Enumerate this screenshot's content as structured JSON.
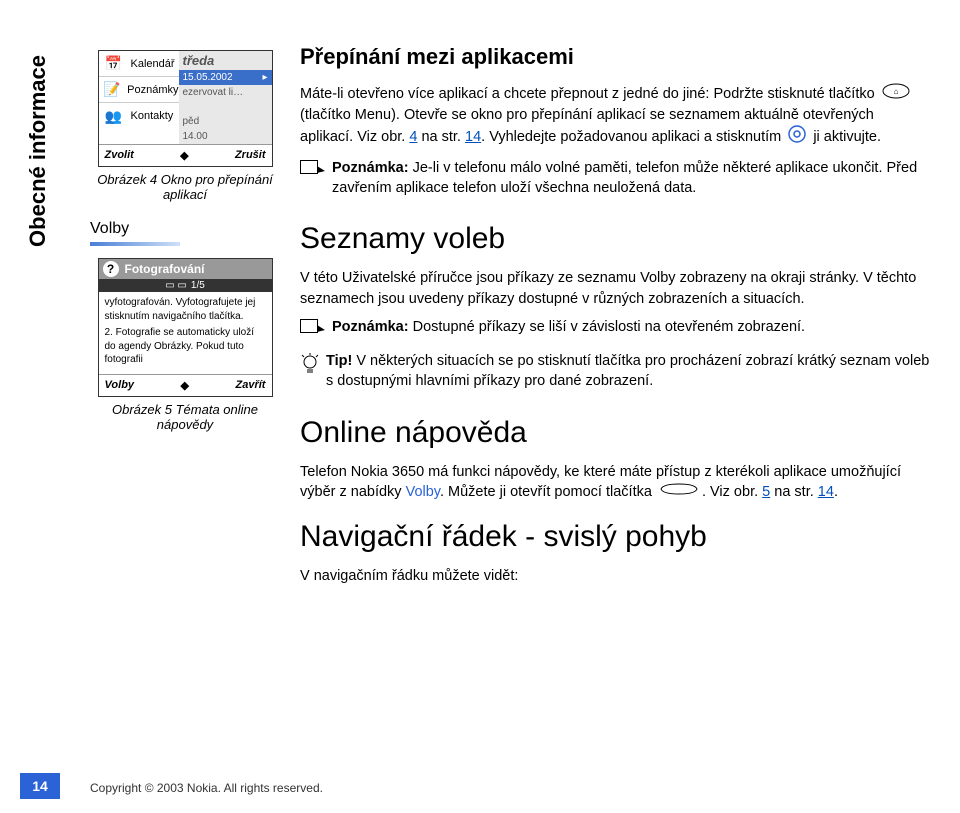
{
  "sidebar_label": "Obecné informace",
  "phone1": {
    "rows": [
      {
        "icon": "📅",
        "label": "Kalendář"
      },
      {
        "icon": "📝",
        "label": "Poznámky"
      },
      {
        "icon": "👥",
        "label": "Kontakty"
      }
    ],
    "overlay_list": [
      "tředa",
      "15.05.2002",
      "ezervovat li…",
      "",
      "pěd",
      "14.00"
    ],
    "soft_left": "Zvolit",
    "soft_right": "Zrušit",
    "caption": "Obrázek 4 Okno pro přepínání aplikací"
  },
  "volby_heading": "Volby",
  "phone2": {
    "title_icon": "?",
    "title": "Fotografování",
    "counter": "1/5",
    "body": [
      "vyfotografován. Vyfotografujete jej stisknutím navigačního tlačítka.",
      "2.  Fotografie se automaticky uloží do agendy Obrázky. Pokud tuto fotografii"
    ],
    "soft_left": "Volby",
    "soft_right": "Zavřít",
    "caption": "Obrázek 5 Témata online nápovědy"
  },
  "main": {
    "h1": "Přepínání mezi aplikacemi",
    "p1a": "Máte-li otevřeno více aplikací a chcete přepnout z jedné do jiné: Podržte stisknuté tlačítko",
    "p1b": "(tlačítko Menu). Otevře se okno pro přepínání aplikací se seznamem aktuálně otevřených aplikací. Viz obr.",
    "link4": "4",
    "p1c": " na str. ",
    "link14a": "14",
    "p1d": ". Vyhledejte požadovanou aplikaci a stisknutím",
    "p1e": "ji aktivujte.",
    "note1_label": "Poznámka:",
    "note1_text": " Je-li v telefonu málo volné paměti, telefon může některé aplikace ukončit. Před zavřením aplikace telefon uloží všechna neuložená data.",
    "h2": "Seznamy voleb",
    "p2": "V této Uživatelské příručce jsou příkazy ze seznamu Volby zobrazeny na okraji stránky. V těchto seznamech jsou uvedeny příkazy dostupné v různých zobrazeních a situacích.",
    "note2_label": "Poznámka:",
    "note2_text": " Dostupné příkazy se liší v závislosti na otevřeném zobrazení.",
    "tip_label": "Tip!",
    "tip_text": " V některých situacích se po stisknutí tlačítka pro procházení zobrazí krátký seznam voleb s dostupnými hlavními příkazy pro dané zobrazení.",
    "h3": "Online nápověda",
    "p3a": "Telefon Nokia 3650 má funkci nápovědy, ke které máte přístup z kterékoli aplikace umožňující výběr z nabídky ",
    "volby_word": "Volby",
    "p3b": ". Můžete ji otevřít pomocí tlačítka",
    "p3c": ". Viz obr. ",
    "link5": "5",
    "p3d": " na str. ",
    "link14b": "14",
    "p3e": ".",
    "h4": "Navigační řádek - svislý pohyb",
    "p4": "V navigačním řádku můžete vidět:"
  },
  "page_number": "14",
  "copyright": "Copyright © 2003 Nokia. All rights reserved."
}
